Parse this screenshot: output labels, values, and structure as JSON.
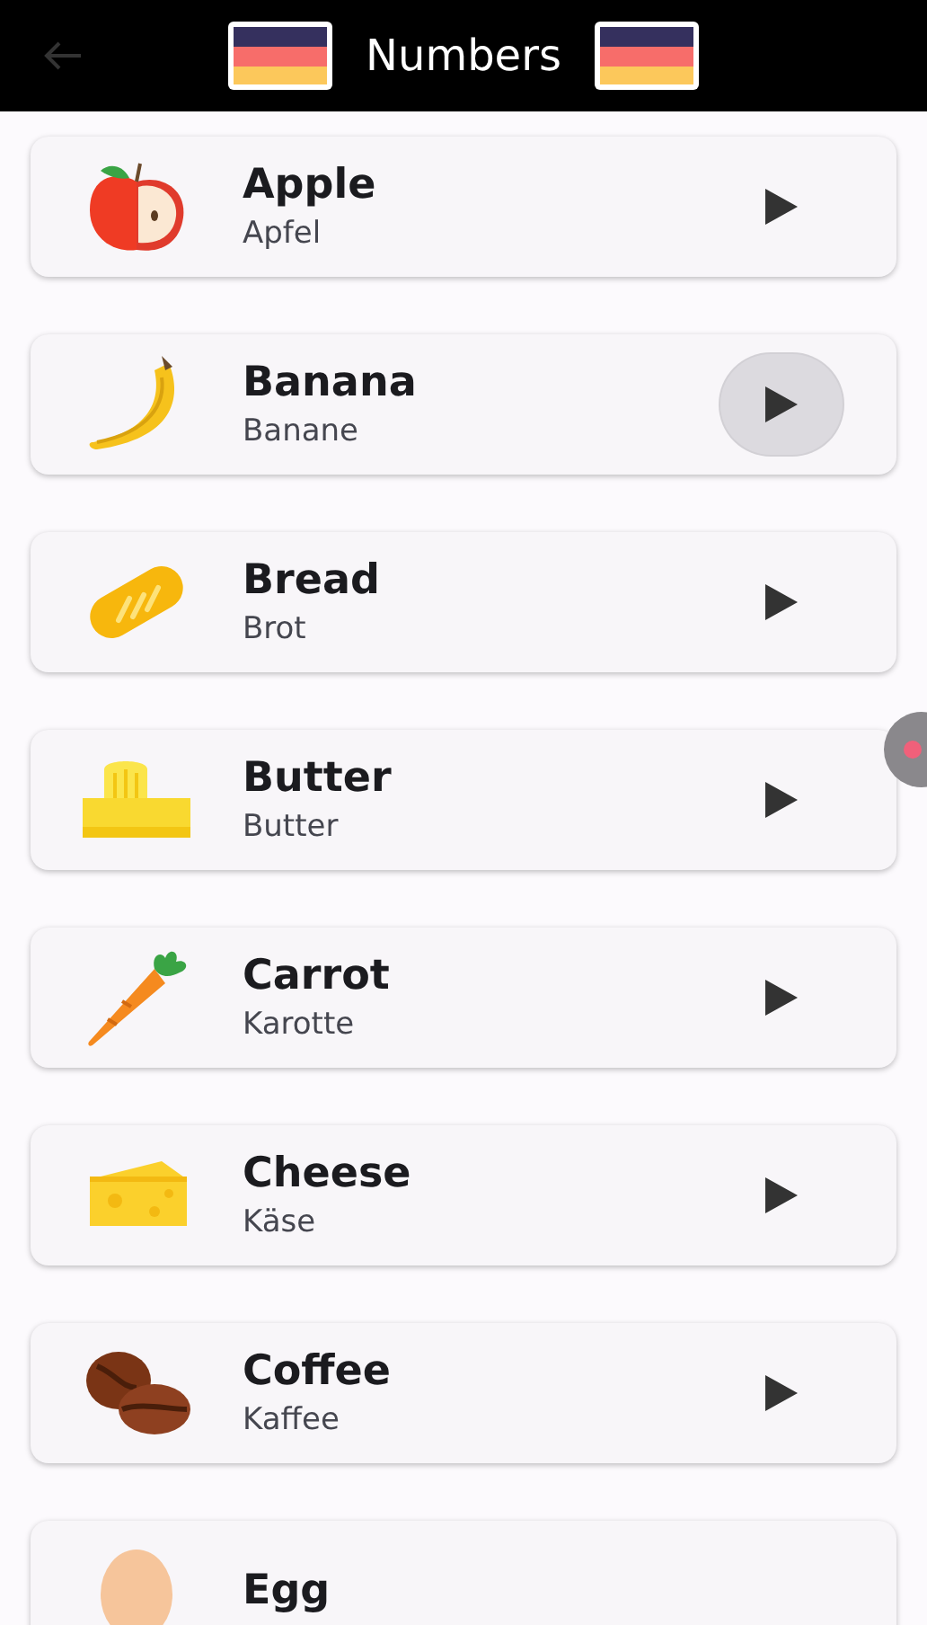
{
  "app_bar": {
    "title": "Numbers"
  },
  "items": [
    {
      "word": "Apple",
      "translation": "Apfel",
      "pressed": false
    },
    {
      "word": "Banana",
      "translation": "Banane",
      "pressed": true
    },
    {
      "word": "Bread",
      "translation": "Brot",
      "pressed": false
    },
    {
      "word": "Butter",
      "translation": "Butter",
      "pressed": false
    },
    {
      "word": "Carrot",
      "translation": "Karotte",
      "pressed": false
    },
    {
      "word": "Cheese",
      "translation": "Käse",
      "pressed": false
    },
    {
      "word": "Coffee",
      "translation": "Kaffee",
      "pressed": false
    },
    {
      "word": "Egg"
    }
  ]
}
